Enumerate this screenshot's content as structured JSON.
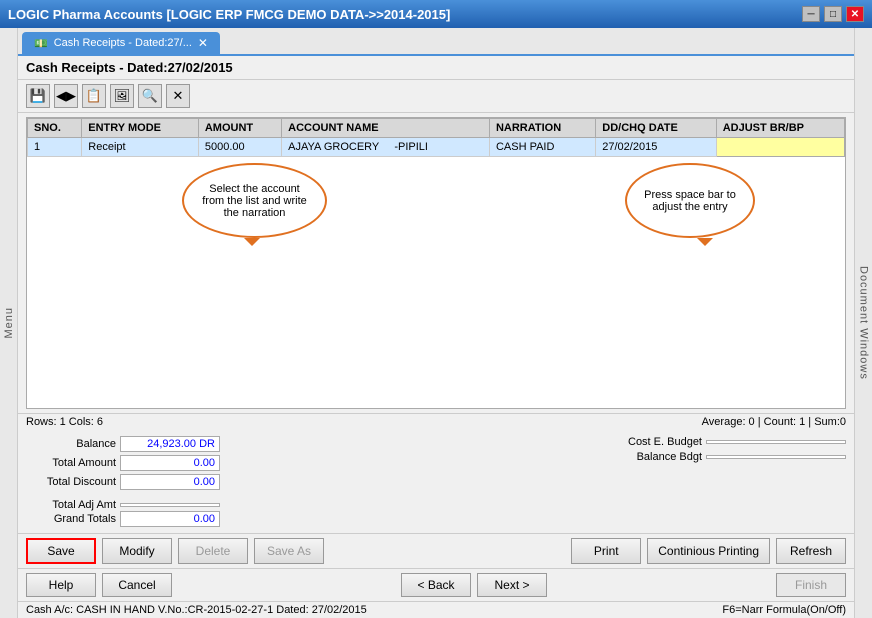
{
  "titleBar": {
    "title": "LOGIC Pharma Accounts  [LOGIC ERP FMCG DEMO DATA->>2014-2015]",
    "minBtn": "─",
    "maxBtn": "□",
    "closeBtn": "✕"
  },
  "sideMenu": {
    "label": "Menu"
  },
  "docSide": {
    "label": "Document Windows"
  },
  "tab": {
    "label": "Cash Receipts - Dated:27/...",
    "closeBtn": "✕"
  },
  "formHeader": {
    "title": "Cash Receipts - Dated:27/02/2015"
  },
  "toolbar": {
    "icons": [
      "💾",
      "◀▶",
      "📋",
      "🖼",
      "🔍",
      "✕"
    ]
  },
  "table": {
    "columns": [
      "SNO.",
      "ENTRY MODE",
      "AMOUNT",
      "ACCOUNT NAME",
      "NARRATION",
      "DD/CHQ DATE",
      "ADJUST BR/BP"
    ],
    "rows": [
      {
        "sno": "1",
        "entryMode": "Receipt",
        "amount": "5000.00",
        "accountName": "AJAYA GROCERY",
        "suffix": "-PIPILI",
        "narration": "CASH PAID",
        "ddChqDate": "27/02/2015",
        "adjustBrBp": ""
      }
    ]
  },
  "callout1": {
    "text": "Select the account from the list and write the narration"
  },
  "callout2": {
    "text": "Press space bar to adjust the entry"
  },
  "rowColInfo": {
    "left": "Rows: 1  Cols: 6",
    "right": "Average: 0 | Count: 1 | Sum:0"
  },
  "summary": {
    "balance_label": "Balance",
    "balance_value": "24,923.00 DR",
    "totalAmount_label": "Total Amount",
    "totalAmount_value": "0.00",
    "totalDiscount_label": "Total Discount",
    "totalDiscount_value": "0.00",
    "totalAdjAmt_label": "Total Adj Amt",
    "totalAdjAmt_value": "",
    "grandTotals_label": "Grand Totals",
    "grandTotals_value": "0.00",
    "costEBudget_label": "Cost E. Budget",
    "costEBudget_value": "",
    "balanceBdgt_label": "Balance Bdgt",
    "balanceBdgt_value": ""
  },
  "actionButtons": {
    "save": "Save",
    "modify": "Modify",
    "delete": "Delete",
    "saveAs": "Save As",
    "print": "Print",
    "continuousPrinting": "Continious Printing",
    "refresh": "Refresh"
  },
  "navButtons": {
    "help": "Help",
    "cancel": "Cancel",
    "back": "< Back",
    "next": "Next >",
    "finish": "Finish"
  },
  "statusBar": {
    "left": "Cash A/c: CASH IN HAND  V.No.:CR-2015-02-27-1  Dated: 27/02/2015",
    "right": "F6=Narr Formula(On/Off)"
  }
}
